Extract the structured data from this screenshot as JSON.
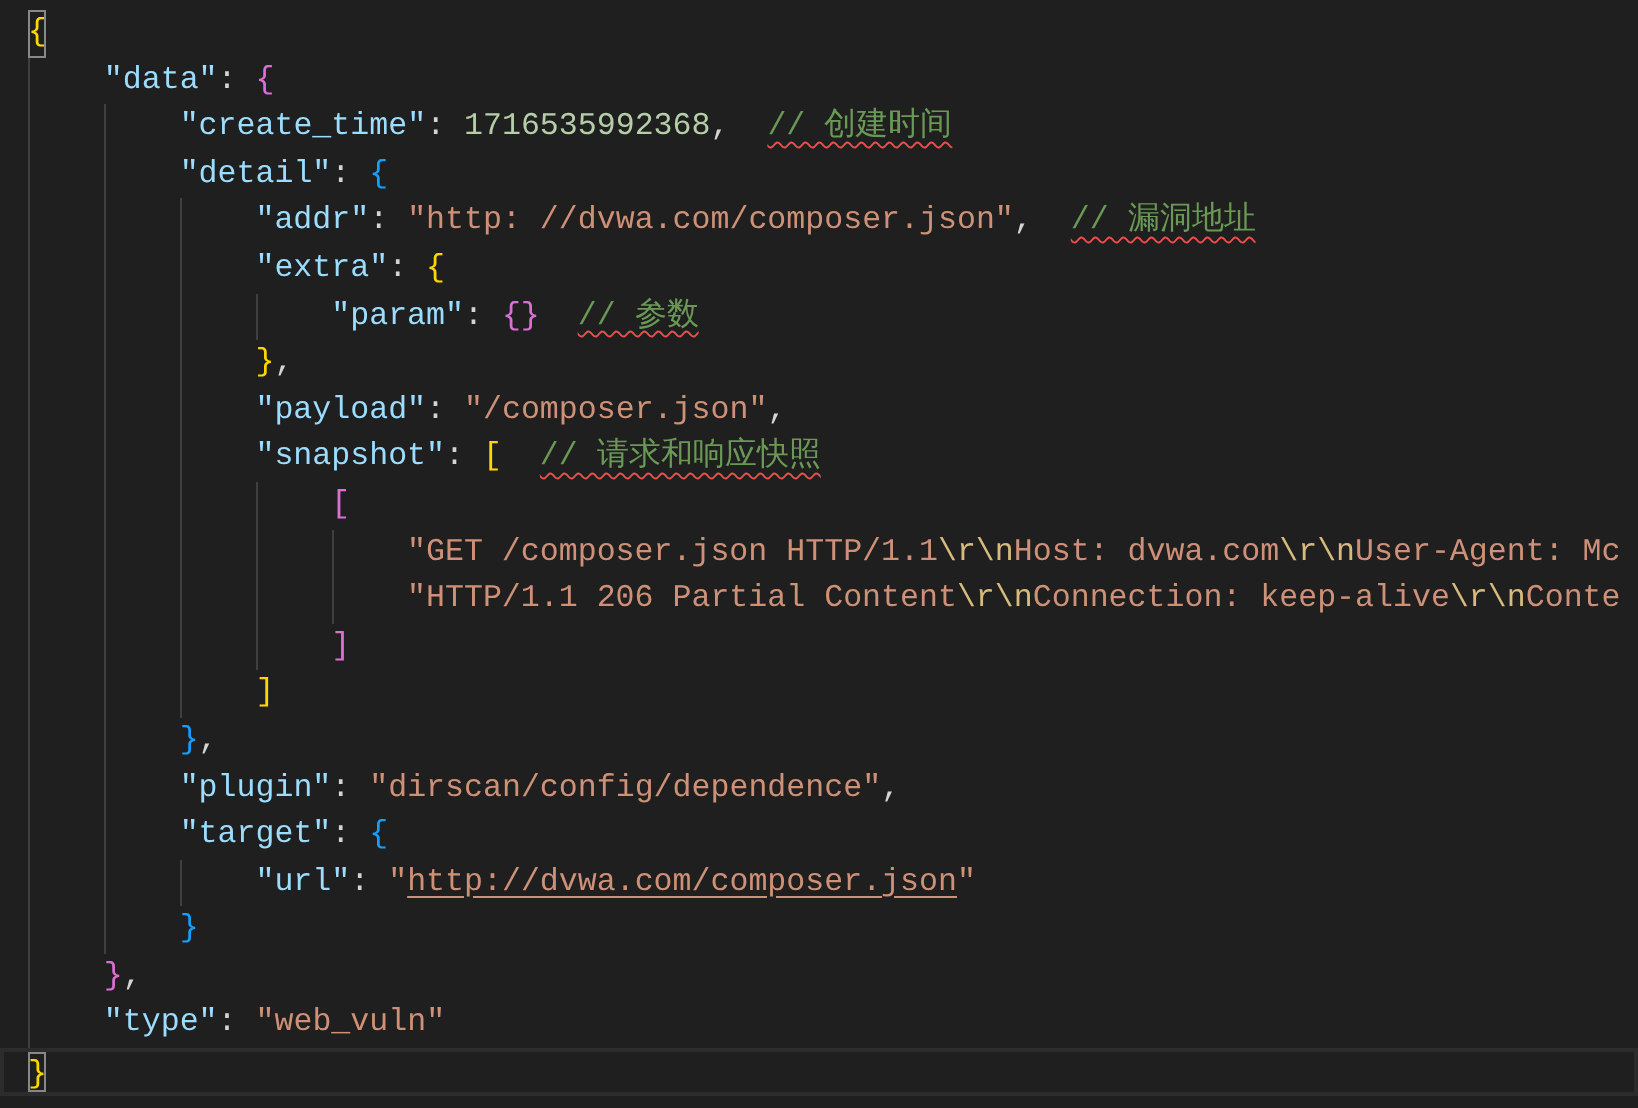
{
  "editor": {
    "lines": [
      {
        "current": false,
        "segments": [
          {
            "kind": "bracket",
            "text": "{",
            "color": "#ffd700",
            "matched": true
          }
        ],
        "children": [
          {
            "current": false,
            "segments": [
              {
                "kind": "key",
                "text": "\"data\""
              },
              {
                "kind": "punct",
                "text": ":"
              },
              {
                "kind": "bracket",
                "text": "{",
                "color": "#da70d6",
                "matched": false
              }
            ],
            "children": [
              {
                "current": false,
                "segments": [
                  {
                    "kind": "key",
                    "text": "\"create_time\""
                  },
                  {
                    "kind": "punct",
                    "text": ":"
                  },
                  {
                    "kind": "number",
                    "text": "1716535992368"
                  },
                  {
                    "kind": "punct",
                    "text": ","
                  },
                  {
                    "kind": "comment",
                    "text": "// 创建时间",
                    "squiggle": true
                  }
                ]
              },
              {
                "current": false,
                "segments": [
                  {
                    "kind": "key",
                    "text": "\"detail\""
                  },
                  {
                    "kind": "punct",
                    "text": ":"
                  },
                  {
                    "kind": "bracket",
                    "text": "{",
                    "color": "#179fff",
                    "matched": false
                  }
                ],
                "children": [
                  {
                    "current": false,
                    "segments": [
                      {
                        "kind": "key",
                        "text": "\"addr\""
                      },
                      {
                        "kind": "punct",
                        "text": ":"
                      },
                      {
                        "kind": "string",
                        "text": "\"http: //dvwa.com/composer.json\""
                      },
                      {
                        "kind": "punct",
                        "text": ","
                      },
                      {
                        "kind": "comment",
                        "text": "// 漏洞地址",
                        "squiggle": true
                      }
                    ]
                  },
                  {
                    "current": false,
                    "segments": [
                      {
                        "kind": "key",
                        "text": "\"extra\""
                      },
                      {
                        "kind": "punct",
                        "text": ":"
                      },
                      {
                        "kind": "bracket",
                        "text": "{",
                        "color": "#ffd700",
                        "matched": false
                      }
                    ],
                    "children": [
                      {
                        "current": false,
                        "segments": [
                          {
                            "kind": "key",
                            "text": "\"param\""
                          },
                          {
                            "kind": "punct",
                            "text": ":"
                          },
                          {
                            "kind": "bracket",
                            "text": "{}",
                            "color": "#da70d6",
                            "matched": false
                          },
                          {
                            "kind": "comment",
                            "text": "// 参数",
                            "squiggle": true
                          }
                        ]
                      }
                    ]
                  },
                  {
                    "current": false,
                    "segments": [
                      {
                        "kind": "bracket",
                        "text": "}",
                        "color": "#ffd700",
                        "matched": false
                      },
                      {
                        "kind": "punct",
                        "text": ","
                      }
                    ]
                  },
                  {
                    "current": false,
                    "segments": [
                      {
                        "kind": "key",
                        "text": "\"payload\""
                      },
                      {
                        "kind": "punct",
                        "text": ":"
                      },
                      {
                        "kind": "string",
                        "text": "\"/composer.json\""
                      },
                      {
                        "kind": "punct",
                        "text": ","
                      }
                    ]
                  },
                  {
                    "current": false,
                    "segments": [
                      {
                        "kind": "key",
                        "text": "\"snapshot\""
                      },
                      {
                        "kind": "punct",
                        "text": ":"
                      },
                      {
                        "kind": "bracket",
                        "text": "[",
                        "color": "#ffd700",
                        "matched": false
                      },
                      {
                        "kind": "comment",
                        "text": "// 请求和响应快照",
                        "squiggle": true
                      }
                    ],
                    "children": [
                      {
                        "current": false,
                        "segments": [
                          {
                            "kind": "bracket",
                            "text": "[",
                            "color": "#da70d6",
                            "matched": false
                          }
                        ],
                        "children": [
                          {
                            "current": false,
                            "segments": [
                              {
                                "kind": "string",
                                "text": "\"GET /composer.json HTTP/1.1"
                              },
                              {
                                "kind": "escape",
                                "text": "\\r\\n"
                              },
                              {
                                "kind": "string",
                                "text": "Host: dvwa.com"
                              },
                              {
                                "kind": "escape",
                                "text": "\\r\\n"
                              },
                              {
                                "kind": "string",
                                "text": "User-Agent: Mc"
                              }
                            ]
                          },
                          {
                            "current": false,
                            "segments": [
                              {
                                "kind": "string",
                                "text": "\"HTTP/1.1 206 Partial Content"
                              },
                              {
                                "kind": "escape",
                                "text": "\\r\\n"
                              },
                              {
                                "kind": "string",
                                "text": "Connection: keep-alive"
                              },
                              {
                                "kind": "escape",
                                "text": "\\r\\n"
                              },
                              {
                                "kind": "string",
                                "text": "Conte"
                              }
                            ]
                          }
                        ]
                      },
                      {
                        "current": false,
                        "segments": [
                          {
                            "kind": "bracket",
                            "text": "]",
                            "color": "#da70d6",
                            "matched": false
                          }
                        ]
                      }
                    ]
                  },
                  {
                    "current": false,
                    "segments": [
                      {
                        "kind": "bracket",
                        "text": "]",
                        "color": "#ffd700",
                        "matched": false
                      }
                    ]
                  }
                ]
              },
              {
                "current": false,
                "segments": [
                  {
                    "kind": "bracket",
                    "text": "}",
                    "color": "#179fff",
                    "matched": false
                  },
                  {
                    "kind": "punct",
                    "text": ","
                  }
                ]
              },
              {
                "current": false,
                "segments": [
                  {
                    "kind": "key",
                    "text": "\"plugin\""
                  },
                  {
                    "kind": "punct",
                    "text": ":"
                  },
                  {
                    "kind": "string",
                    "text": "\"dirscan/config/dependence\""
                  },
                  {
                    "kind": "punct",
                    "text": ","
                  }
                ]
              },
              {
                "current": false,
                "segments": [
                  {
                    "kind": "key",
                    "text": "\"target\""
                  },
                  {
                    "kind": "punct",
                    "text": ":"
                  },
                  {
                    "kind": "bracket",
                    "text": "{",
                    "color": "#179fff",
                    "matched": false
                  }
                ],
                "children": [
                  {
                    "current": false,
                    "segments": [
                      {
                        "kind": "key",
                        "text": "\"url\""
                      },
                      {
                        "kind": "punct",
                        "text": ":"
                      },
                      {
                        "kind": "string",
                        "text": "\""
                      },
                      {
                        "kind": "link",
                        "text": "http://dvwa.com/composer.json"
                      },
                      {
                        "kind": "string",
                        "text": "\""
                      }
                    ]
                  }
                ]
              },
              {
                "current": false,
                "segments": [
                  {
                    "kind": "bracket",
                    "text": "}",
                    "color": "#179fff",
                    "matched": false
                  }
                ]
              }
            ]
          },
          {
            "current": false,
            "segments": [
              {
                "kind": "bracket",
                "text": "}",
                "color": "#da70d6",
                "matched": false
              },
              {
                "kind": "punct",
                "text": ","
              }
            ]
          },
          {
            "current": false,
            "segments": [
              {
                "kind": "key",
                "text": "\"type\""
              },
              {
                "kind": "punct",
                "text": ":"
              },
              {
                "kind": "string",
                "text": "\"web_vuln\""
              }
            ]
          }
        ]
      },
      {
        "current": true,
        "segments": [
          {
            "kind": "bracket",
            "text": "}",
            "color": "#ffd700",
            "matched": true
          }
        ]
      }
    ]
  }
}
